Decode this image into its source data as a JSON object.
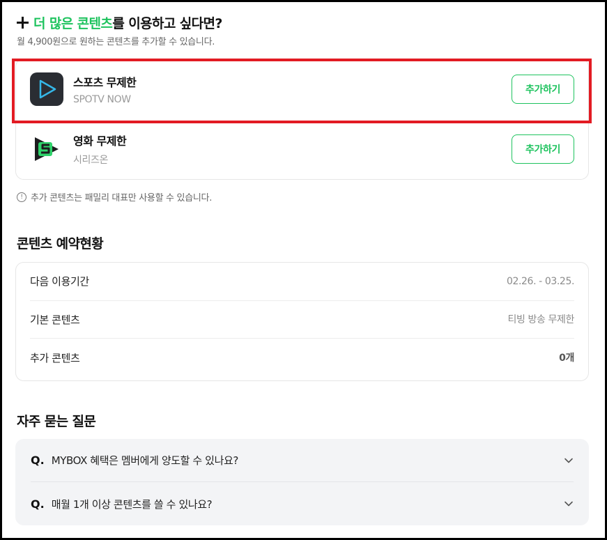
{
  "promo": {
    "title_highlight": "더 많은 콘텐츠",
    "title_rest": "를 이용하고 싶다면?",
    "subtitle": "월 4,900원으로 원하는 콘텐츠를 추가할 수 있습니다.",
    "icon": "plus-icon"
  },
  "addons": [
    {
      "name": "스포츠 무제한",
      "provider": "SPOTV NOW",
      "button": "추가하기",
      "icon": "spotv-play-icon",
      "highlighted": true
    },
    {
      "name": "영화 무제한",
      "provider": "시리즈온",
      "button": "추가하기",
      "icon": "serieson-logo-icon",
      "highlighted": false
    }
  ],
  "notice": {
    "icon": "info-icon",
    "text": "추가 콘텐츠는 패밀리 대표만 사용할 수 있습니다."
  },
  "reservation": {
    "title": "콘텐츠 예약현황",
    "rows": [
      {
        "label": "다음 이용기간",
        "value": "02.26. - 03.25."
      },
      {
        "label": "기본 콘텐츠",
        "value": "티빙 방송 무제한"
      },
      {
        "label": "추가 콘텐츠",
        "value": "0개"
      }
    ]
  },
  "faq": {
    "title": "자주 묻는 질문",
    "prefix": "Q.",
    "items": [
      {
        "question": "MYBOX 혜택은 멤버에게 양도할 수 있나요?"
      },
      {
        "question": "매월 1개 이상 콘텐츠를 쓸 수 있나요?"
      }
    ]
  },
  "colors": {
    "accent": "#1ec35e",
    "highlight_border": "#e21b23",
    "faq_bg": "#f3f4f6"
  }
}
